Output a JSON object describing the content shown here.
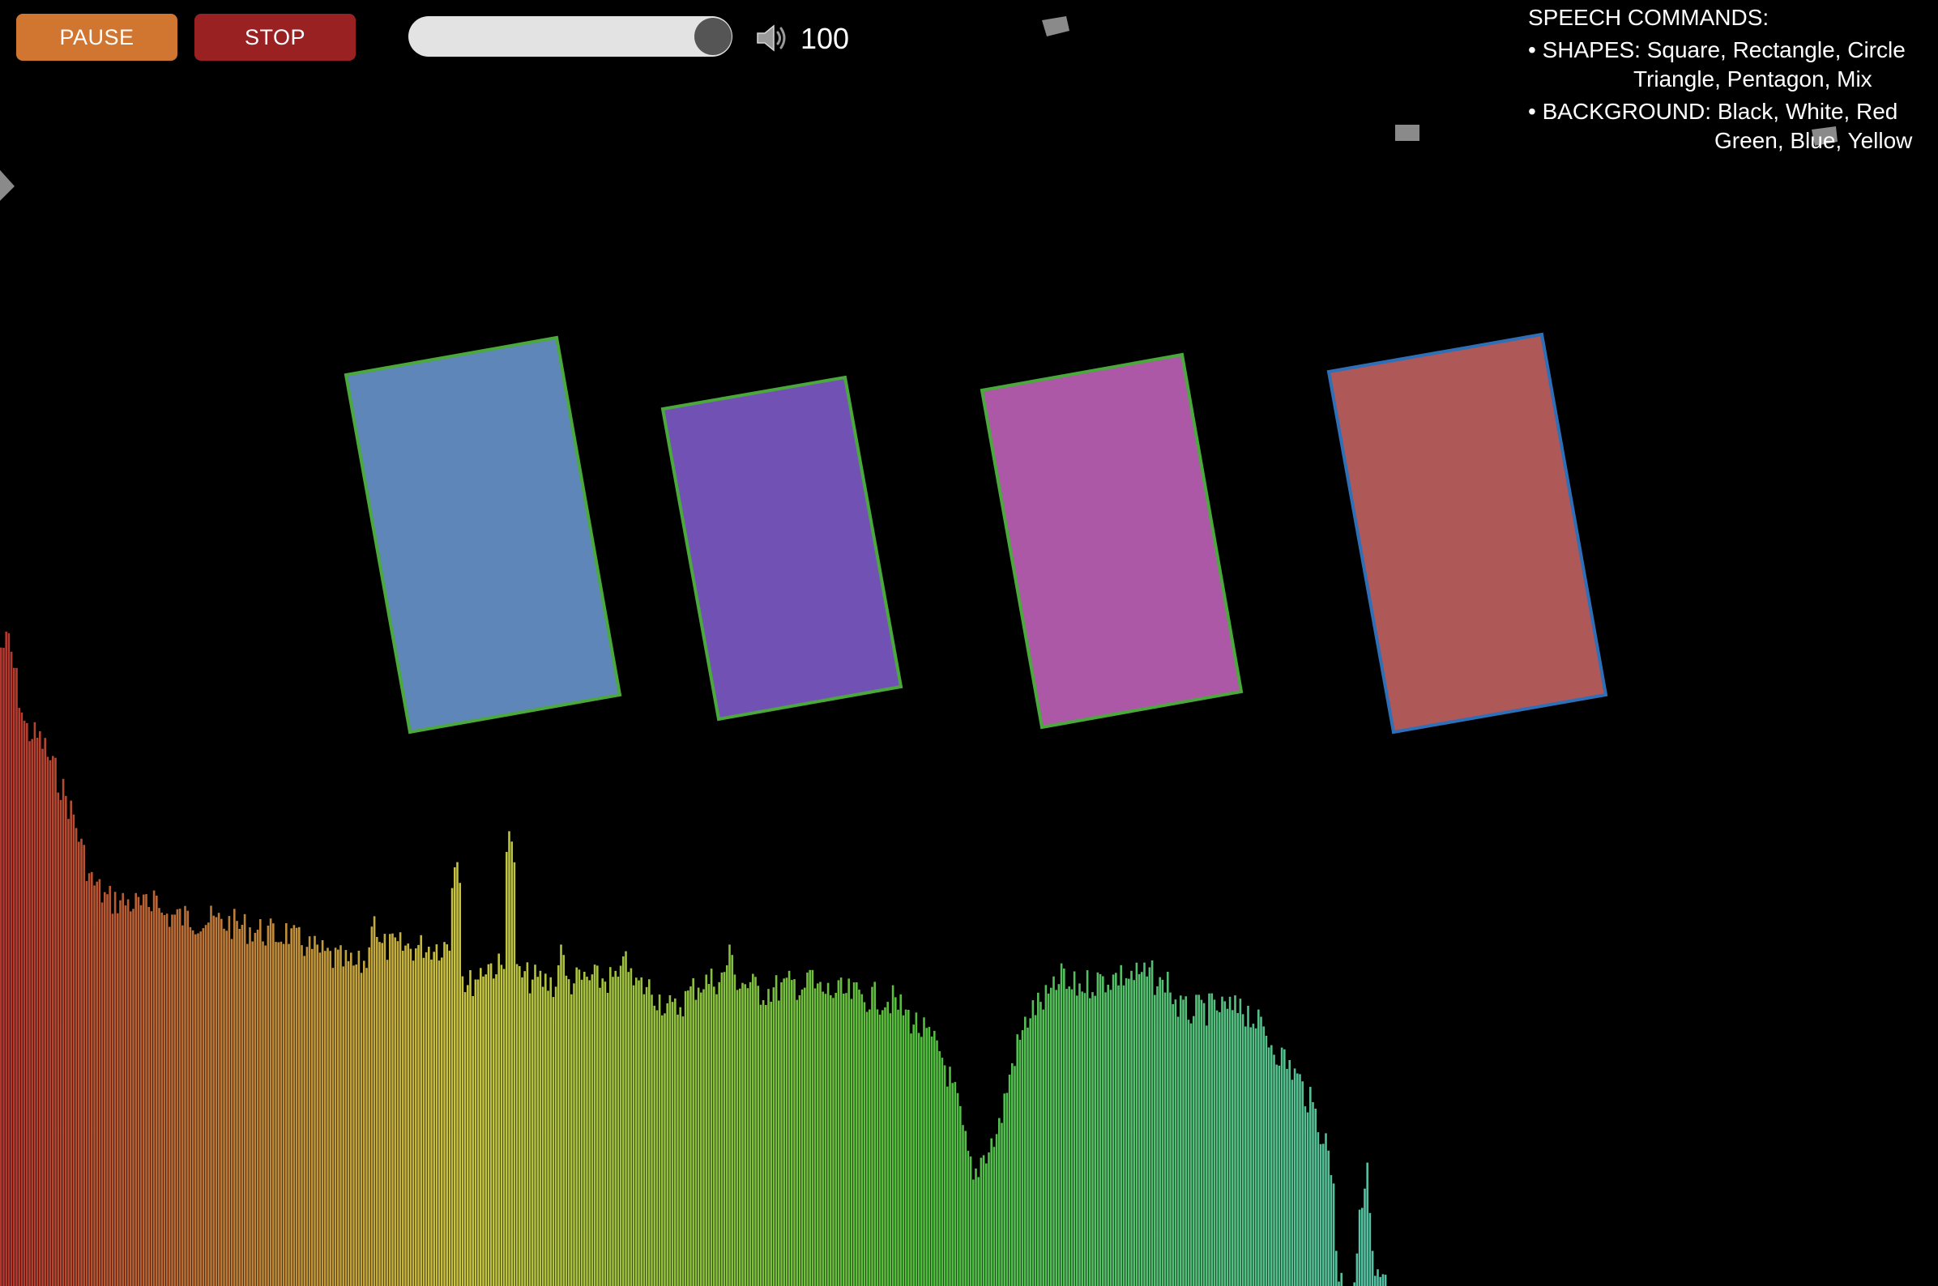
{
  "controls": {
    "pause_label": "PAUSE",
    "stop_label": "STOP",
    "pause_color": "#d07630",
    "stop_color": "#9a2121"
  },
  "volume": {
    "icon": "speaker-icon",
    "value": "100",
    "level": 1.0
  },
  "speech_commands": {
    "title": "SPEECH COMMANDS:",
    "shapes_line1": "• SHAPES: Square, Rectangle, Circle",
    "shapes_line2": "Triangle, Pentagon, Mix",
    "background_line1": "• BACKGROUND: Black, White, Red",
    "background_line2": "Green, Blue, Yellow"
  },
  "scene": {
    "background_color": "#000000",
    "shapes": [
      {
        "type": "rectangle",
        "fill": "#5f86b8",
        "stroke": "#4aa83c"
      },
      {
        "type": "rectangle",
        "fill": "#7152b4",
        "stroke": "#4aa83c"
      },
      {
        "type": "rectangle",
        "fill": "#ad58a6",
        "stroke": "#4aa83c"
      },
      {
        "type": "rectangle",
        "fill": "#ae5857",
        "stroke": "#2f6fb8"
      }
    ],
    "particle_color": "#8a8a8a"
  },
  "spectrum": {
    "gradient_colors": [
      "#b3372f",
      "#c8c440",
      "#53bd3d",
      "#55c1a6"
    ]
  }
}
